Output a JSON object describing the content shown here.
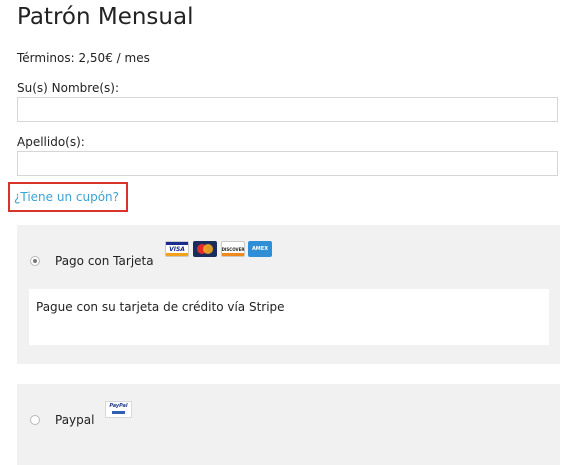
{
  "page": {
    "title": "Patrón Mensual",
    "terms": "Términos: 2,50€ / mes"
  },
  "form": {
    "first_name_label": "Su(s) Nombre(s):",
    "first_name_value": "",
    "last_name_label": "Apellido(s):",
    "last_name_value": ""
  },
  "coupon": {
    "link_text": "¿Tiene un cupón?"
  },
  "payment": {
    "card": {
      "label": "Pago con Tarjeta",
      "selected": true,
      "logos": [
        "VISA",
        "MasterCard",
        "DISCOVER",
        "AMEX"
      ],
      "description": "Pague con su tarjeta de crédito vía Stripe"
    },
    "paypal": {
      "label": "Paypal",
      "selected": false,
      "logo_text": "PayPal"
    }
  },
  "colors": {
    "link": "#3aa3d4",
    "highlight_border": "#d9342b",
    "panel_bg": "#f1f1f1"
  }
}
